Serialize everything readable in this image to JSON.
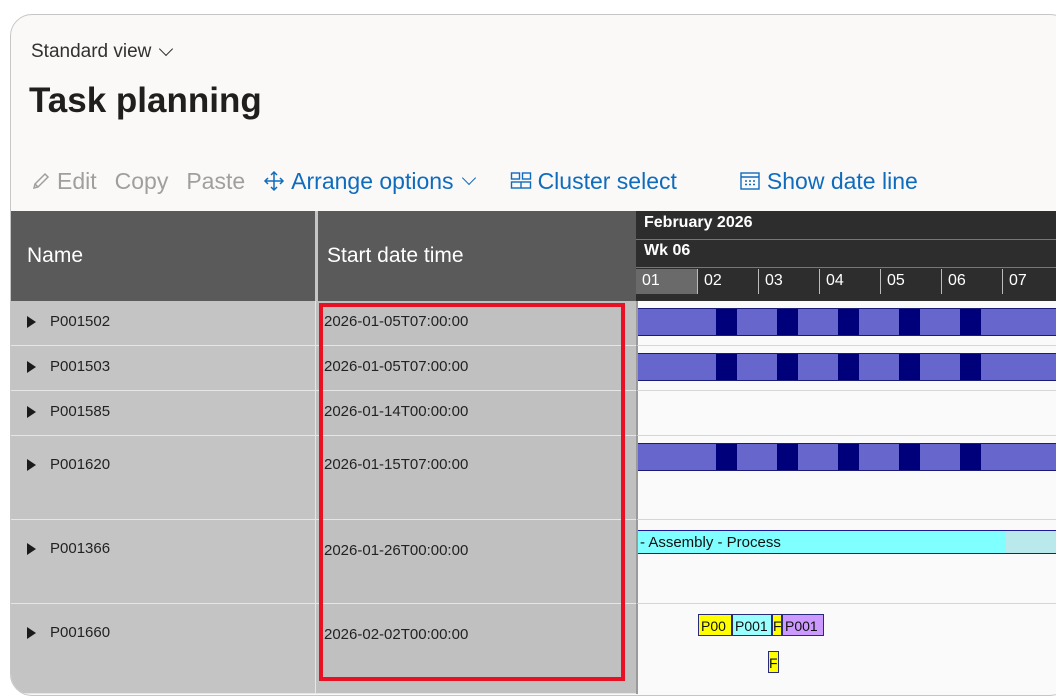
{
  "header": {
    "view_label": "Standard view",
    "title": "Task planning"
  },
  "toolbar": {
    "edit": "Edit",
    "copy": "Copy",
    "paste": "Paste",
    "arrange": "Arrange options",
    "cluster": "Cluster select",
    "show_date": "Show date line"
  },
  "columns": {
    "name": "Name",
    "start": "Start date time"
  },
  "gantt": {
    "month": "February 2026",
    "week": "Wk 06",
    "days": [
      "01",
      "02",
      "03",
      "04",
      "05",
      "06",
      "07"
    ]
  },
  "rows": [
    {
      "name": "P001502",
      "start": "2026-01-05T07:00:00"
    },
    {
      "name": "P001503",
      "start": "2026-01-05T07:00:00"
    },
    {
      "name": "P001585",
      "start": "2026-01-14T00:00:00"
    },
    {
      "name": "P001620",
      "start": "2026-01-15T07:00:00"
    },
    {
      "name": "P001366",
      "start": "2026-01-26T00:00:00",
      "bar_label": "- Assembly - Process"
    },
    {
      "name": "P001660",
      "start": "2026-02-02T00:00:00",
      "tags": [
        "P00",
        "P001",
        "F",
        "P001",
        "F"
      ]
    }
  ],
  "colors": {
    "accent": "#0f6cbd",
    "bar": "#6666cc",
    "bar_dark": "#00007a",
    "cyan": "#7fffff",
    "highlight": "#e81123",
    "tag_yellow": "#ffff00",
    "tag_cyan": "#99ffff",
    "tag_purple": "#cc99ff"
  },
  "icons": {
    "edit": "pencil-icon",
    "arrange": "move-arrows-icon",
    "cluster": "cluster-grid-icon",
    "show_date": "calendar-icon",
    "expand": "expand-triangle-icon"
  }
}
